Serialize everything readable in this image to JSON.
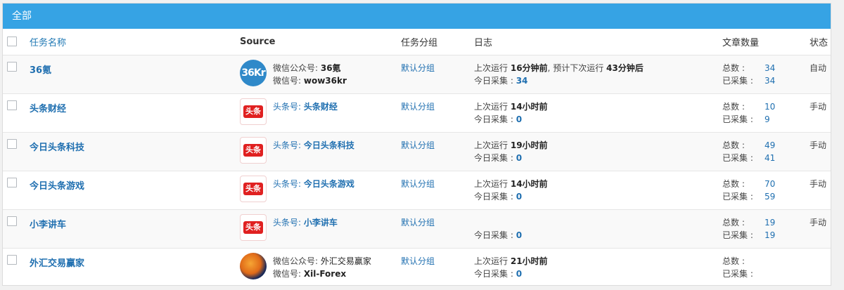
{
  "panel": {
    "title": "全部"
  },
  "columns": {
    "name": "任务名称",
    "source": "Source",
    "group": "任务分组",
    "log": "日志",
    "count": "文章数量",
    "status": "状态"
  },
  "labels": {
    "last_run": "上次运行",
    "next_run": "预计下次运行",
    "today": "今日采集 :",
    "total": "总数 :",
    "collected": "已采集 :"
  },
  "rows": [
    {
      "name": "36氪",
      "logo": "36kr-logo",
      "source_label_1": "微信公众号: ",
      "source_value_1": "36氪",
      "source_label_2": "微信号: ",
      "source_value_2": "wow36kr",
      "group": "默认分组",
      "last_run_value": "16分钟前",
      "next_run_value": "43分钟后",
      "today_count": "34",
      "total": "34",
      "collected": "34",
      "status": "自动"
    },
    {
      "name": "头条财经",
      "logo": "toutiao-logo",
      "source_label_1": "头条号: ",
      "source_value_1": "头条财经",
      "group": "默认分组",
      "last_run_value": "14小时前",
      "today_count": "0",
      "total": "10",
      "collected": "9",
      "status": "手动"
    },
    {
      "name": "今日头条科技",
      "logo": "toutiao-logo",
      "source_label_1": "头条号: ",
      "source_value_1": "今日头条科技",
      "group": "默认分组",
      "last_run_value": "19小时前",
      "today_count": "0",
      "total": "49",
      "collected": "41",
      "status": "手动"
    },
    {
      "name": "今日头条游戏",
      "logo": "toutiao-logo",
      "source_label_1": "头条号: ",
      "source_value_1": "今日头条游戏",
      "group": "默认分组",
      "last_run_value": "14小时前",
      "today_count": "0",
      "total": "70",
      "collected": "59",
      "status": "手动"
    },
    {
      "name": "小李讲车",
      "logo": "toutiao-logo",
      "source_label_1": "头条号: ",
      "source_value_1": "小李讲车",
      "group": "默认分组",
      "today_count": "0",
      "total": "19",
      "collected": "19",
      "status": "手动"
    },
    {
      "name": "外汇交易赢家",
      "logo": "forex-logo",
      "source_label_1": "微信公众号: ",
      "source_value_1": "外汇交易赢家",
      "source_label_2": "微信号: ",
      "source_value_2": "Xil-Forex",
      "group": "默认分组",
      "last_run_value": "21小时前",
      "today_count": "0",
      "total": "",
      "collected": "",
      "status": ""
    }
  ],
  "logo_texts": {
    "kr": "36Kr",
    "toutiao": "头条"
  }
}
